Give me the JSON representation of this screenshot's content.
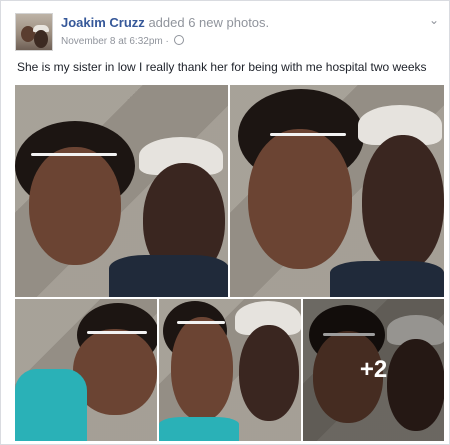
{
  "post": {
    "author": "Joakim Cruzz",
    "action": "added 6 new photos.",
    "date": "November 8 at 6:32pm ·",
    "caption": "She is my sister in low I really thank her for being with me hospital two weeks",
    "more_photos": "+2"
  },
  "icons": {
    "menu": "chevron-down-icon",
    "privacy": "globe-icon"
  },
  "colors": {
    "link": "#365899",
    "meta": "#90949c",
    "text": "#1d2129"
  }
}
